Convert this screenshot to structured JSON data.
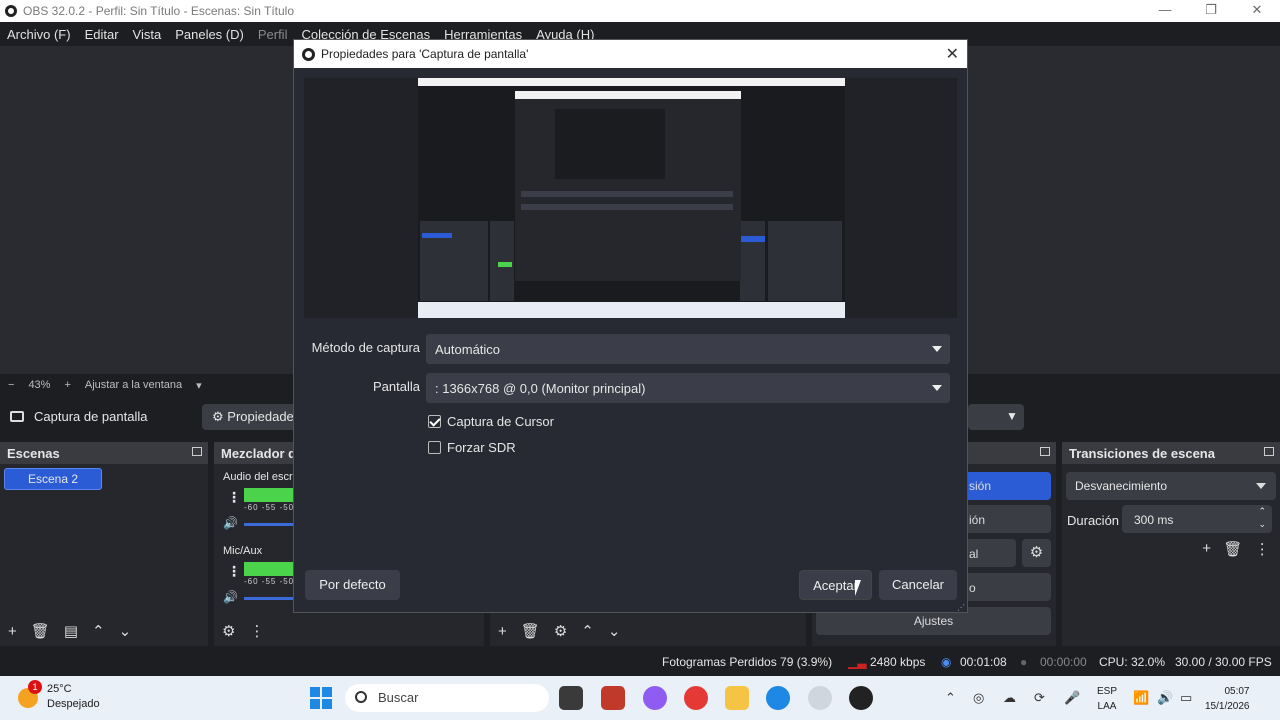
{
  "window": {
    "title": "OBS 32.0.2 - Perfil: Sin Título - Escenas: Sin Título",
    "controls": [
      "—",
      "❐",
      "✕"
    ]
  },
  "menu": {
    "items": [
      "Archivo (F)",
      "Editar",
      "Vista",
      "Paneles (D)",
      "Perfil",
      "Colección de Escenas",
      "Herramientas",
      "Ayuda (H)"
    ]
  },
  "zoom": {
    "minus": "−",
    "value": "43%",
    "plus": "+",
    "fit": "Ajustar a la ventana"
  },
  "sourcebar": {
    "source_name": "Captura de pantalla",
    "properties_label": "Propiedades"
  },
  "scenes": {
    "title": "Escenas",
    "items": [
      "Escena 2"
    ]
  },
  "mixer": {
    "title": "Mezclador d",
    "channels": [
      {
        "name": "Audio del escri",
        "scale": "-60 -55 -50"
      },
      {
        "name": "Mic/Aux",
        "scale": "-60 -55 -50"
      }
    ]
  },
  "controls": {
    "buttons": [
      "sión",
      "ión",
      "al",
      "o",
      "Ajustes"
    ]
  },
  "transitions": {
    "title": "Transiciones de escena",
    "selected": "Desvanecimiento",
    "duration_label": "Duración",
    "duration_value": "300 ms"
  },
  "status": {
    "frames_dropped": "Fotogramas Perdidos 79 (3.9%)",
    "bitrate": "2480 kbps",
    "rec_time": "00:01:08",
    "stream_time": "00:00:00",
    "cpu": "CPU: 32.0%",
    "fps": "30.00 / 30.00 FPS"
  },
  "dialog": {
    "title": "Propiedades para 'Captura de pantalla'",
    "close": "✕",
    "capture_method_label": "Método de captura",
    "capture_method_value": "Automático",
    "display_label": "Pantalla",
    "display_value": ": 1366x768 @ 0,0 (Monitor principal)",
    "capture_cursor_label": "Captura de Cursor",
    "capture_cursor_checked": true,
    "force_sdr_label": "Forzar SDR",
    "force_sdr_checked": false,
    "defaults_button": "Por defecto",
    "ok_button": "Aceptar",
    "cancel_button": "Cancelar"
  },
  "taskbar": {
    "weather_temp": "25°C",
    "weather_desc": "Despejado",
    "weather_badge": "1",
    "search_placeholder": "Buscar",
    "lang_top": "ESP",
    "lang_bottom": "LAA",
    "time": "05:07",
    "date": "15/1/2026"
  }
}
